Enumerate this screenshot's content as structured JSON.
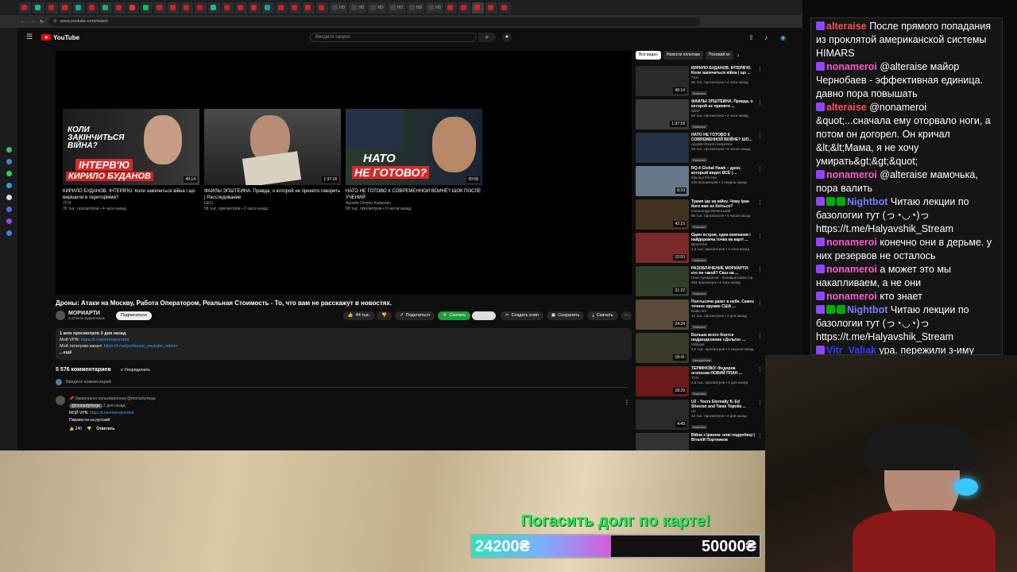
{
  "browser": {
    "tabs": [
      "",
      "",
      "",
      "",
      "",
      "",
      "",
      "",
      "",
      "",
      "",
      "",
      "",
      "",
      "",
      "",
      "",
      "",
      "",
      "",
      "",
      "",
      "",
      "HD",
      "HD",
      "HD",
      "HD",
      "HD",
      "HD",
      "",
      "",
      "",
      "",
      ""
    ],
    "url": "www.youtube.com/watch"
  },
  "youtube": {
    "logo": "YouTube",
    "search_placeholder": "Введите запрос",
    "endcards": [
      {
        "title": "КИРИЛО БУДАНОВ. ІНТЕРВ'Ю. Коли закінчиться війна і що вирішили в територіями?",
        "channel": "ТСН",
        "meta": "35 тыс. просмотров • 4 часа назад",
        "duration": "49:14",
        "overlay_top": "КОЛИ ЗАКІНЧИТЬСЯ ВІЙНА?",
        "overlay_band": "ІНТЕРВ'Ю",
        "overlay_bottom": "КИРИЛО БУДАНОВ"
      },
      {
        "title": "ФАЙЛЫ ЭПШТЕЙНА. Правда, о которой не принято говорить | Расследование",
        "channel": "GEO",
        "meta": "58 тыс. просмотров • 2 часа назад",
        "duration": "1:37:18"
      },
      {
        "title": "НАТО НЕ ГОТОВО К СОВРЕМЕННОЙ ВОЙНЕ? ШОК ПОСЛЕ УЧЕНИЙ",
        "channel": "Apostle Dmytro Karpenko",
        "meta": "58 тыс. просмотров • 9 часов назад",
        "duration": "20:58",
        "overlay_top": "НАТО",
        "overlay_bottom": "НЕ ГОТОВО?"
      }
    ],
    "video_title": "Дроны: Атаки на Москву, Работа Оператором, Реальная Стоимость - То, что вам не расскажут в новостях.",
    "channel_name": "МОРИАРТИ",
    "subscribers": "3,23 млн подписчиков",
    "subscribe_label": "Подписаться",
    "likes": "44 тыс.",
    "share_label": "Поделиться",
    "download_green_label": "Скачать",
    "clip_label": "Создать клип",
    "save_label": "Сохранить",
    "download_label": "Скачать",
    "desc": {
      "stats": "1 млн просмотров  3 дня назад",
      "vpn_label": "Мой VPN: ",
      "vpn_link": "https://t.me/morivpnrobot",
      "tg_label": "Мой телеграм-канал: ",
      "tg_link": "https://t.me/professor_youtube_reborn",
      "more": "...ещё"
    },
    "comments_count": "5 576 комментариев",
    "sort_label": "Упорядочить",
    "comment_placeholder": "Введите комментарий",
    "pinned": {
      "pinned_by": "Закреплено пользователем @moriartymega",
      "author": "@moriartymega",
      "time": "2 дня назад",
      "line1_label": "МОЙ VPN: ",
      "line1_link": "https://t.me/morivpnrobot",
      "line2": "Пиравости на русский",
      "likes": "240",
      "reply": "Ответить"
    },
    "chips": [
      "Все видео",
      "Новости политики",
      "Похожий ко"
    ],
    "sidebar": [
      {
        "title": "КИРИЛО БУДАНОВ. ІНТЕРВ'Ю. Коли закінчиться війна | що ...",
        "channel": "ТСН",
        "meta": "35 тыс. просмотров • 4 часа назад",
        "badge": "Новинка",
        "duration": "49:14"
      },
      {
        "title": "ФАЙЛЫ ЭПШТЕЙНА. Правда, о которой не принято ...",
        "channel": "GEO",
        "meta": "58 тыс. просмотров • 2 часа назад",
        "badge": "Новинка",
        "duration": "1:37:18"
      },
      {
        "title": "НАТО НЕ ГОТОВО К СОВРЕМЕННОЙ ВОЙНЕ? ШО...",
        "channel": "Apostle Dmytro Karpenko",
        "meta": "58 тыс. просмотров • 9 часов назад",
        "badge": "Новинка",
        "duration": ""
      },
      {
        "title": "RQ-4 Global Hawk – дрон, который видит ВСЁ | ...",
        "channel": "Крылья России",
        "meta": "240 просмотров • 3 недели назад",
        "badge": "",
        "duration": "6:10"
      },
      {
        "title": "Трамп іде на війну. Чому Іран його вже не боїться?",
        "channel": "Олександр Моченський",
        "meta": "65 тыс. просмотров • 5 часов назад",
        "badge": "Новинка",
        "duration": "42:15"
      },
      {
        "title": "Один остров, одна компания і найдорожча точка на карті ...",
        "channel": "Валентин",
        "meta": "4,3 тыс. просмотров • 4 часа назад",
        "badge": "Новинка",
        "duration": "12:53"
      },
      {
        "title": "РАЗОБЛАЧЕНИЕ МОРИАРТИ: кто он такой? Сказ на ...",
        "channel": "Олег Артамонов - Ленивый инвестор",
        "meta": "454 просмотра • 4 часа назад",
        "badge": "Новинка",
        "duration": "21:22"
      },
      {
        "title": "Полтысячи ракет в небе. Самое точное оружие США ...",
        "channel": "Radio NV",
        "meta": "14 тыс. просмотров • 4 дня назад",
        "badge": "Новинка",
        "duration": "24:34"
      },
      {
        "title": "Больше всего боится подразделение «Дельта» ...",
        "channel": "Militopia",
        "meta": "4,6 тыс. просмотров • 3 недели назад",
        "badge": "Автодубляж",
        "duration": "18:41"
      },
      {
        "title": "ТЕРМІНОВО! Федоров оголосив НОВИЙ ПЛАН ...",
        "channel": "ТСН",
        "meta": "4,8 тыс. просмотров • 4 дня назад",
        "badge": "Новинка",
        "duration": "18:29"
      },
      {
        "title": "U2 - Yours Eternally ft. Ed Sheeran and Taras Topolia ...",
        "channel": "U2",
        "meta": "24 тыс. просмотров • 4 дня назад",
        "badge": "Новинка",
        "duration": "4:49"
      },
      {
        "title": "Війна з Іраном: нові подробиці | Віталій Портников",
        "channel": "",
        "meta": "",
        "badge": "",
        "duration": ""
      }
    ]
  },
  "chat": [
    {
      "user": "alteraise",
      "color": "#ff4f4f",
      "text": "После прямого попадания из проклятой американской системы HIMARS",
      "badges": [
        "#9146ff"
      ]
    },
    {
      "user": "nonameroi",
      "color": "#ff5ad2",
      "text": "@alteraise майор Чернобаев - эффективная единица. давно пора повышать",
      "badges": [
        "#9146ff"
      ]
    },
    {
      "user": "alteraise",
      "color": "#ff4f4f",
      "text": "@nonameroi &quot;...сначала ему оторвало ноги, а потом он догорел. Он кричал &lt;&lt;Мама, я не хочу умирать&gt;&gt;&quot;",
      "badges": [
        "#9146ff"
      ]
    },
    {
      "user": "nonameroi",
      "color": "#ff5ad2",
      "text": "@alteraise мамочька, пора валить",
      "badges": [
        "#9146ff"
      ]
    },
    {
      "user": "Nightbot",
      "color": "#7c7cff",
      "text": "Читаю лекции по базологии тут (っ◔◡◔)っ https://t.me/Halyavshik_Stream",
      "badges": [
        "#9146ff",
        "#00ad03",
        "#00ad03"
      ]
    },
    {
      "user": "nonameroi",
      "color": "#ff5ad2",
      "text": "конечно они в дерьме. у них резервов не осталось",
      "badges": [
        "#9146ff"
      ]
    },
    {
      "user": "nonameroi",
      "color": "#ff5ad2",
      "text": "а может это мы накапливаем, а не они",
      "badges": [
        "#9146ff"
      ]
    },
    {
      "user": "nonameroi",
      "color": "#ff5ad2",
      "text": "кто знает",
      "badges": [
        "#9146ff"
      ]
    },
    {
      "user": "Nightbot",
      "color": "#7c7cff",
      "text": "Читаю лекции по базологии тут (っ◔◡◔)っ https://t.me/Halyavshik_Stream",
      "badges": [
        "#9146ff",
        "#00ad03",
        "#00ad03"
      ]
    },
    {
      "user": "Vitr_Valiak",
      "color": "#2f3fff",
      "text": "ура. пережили з-иму",
      "badges": [
        "#9146ff"
      ]
    }
  ],
  "donation": {
    "title": "Погасить долг по карте!",
    "current": "24200₴",
    "goal": "50000₴",
    "progress": 0.484
  }
}
